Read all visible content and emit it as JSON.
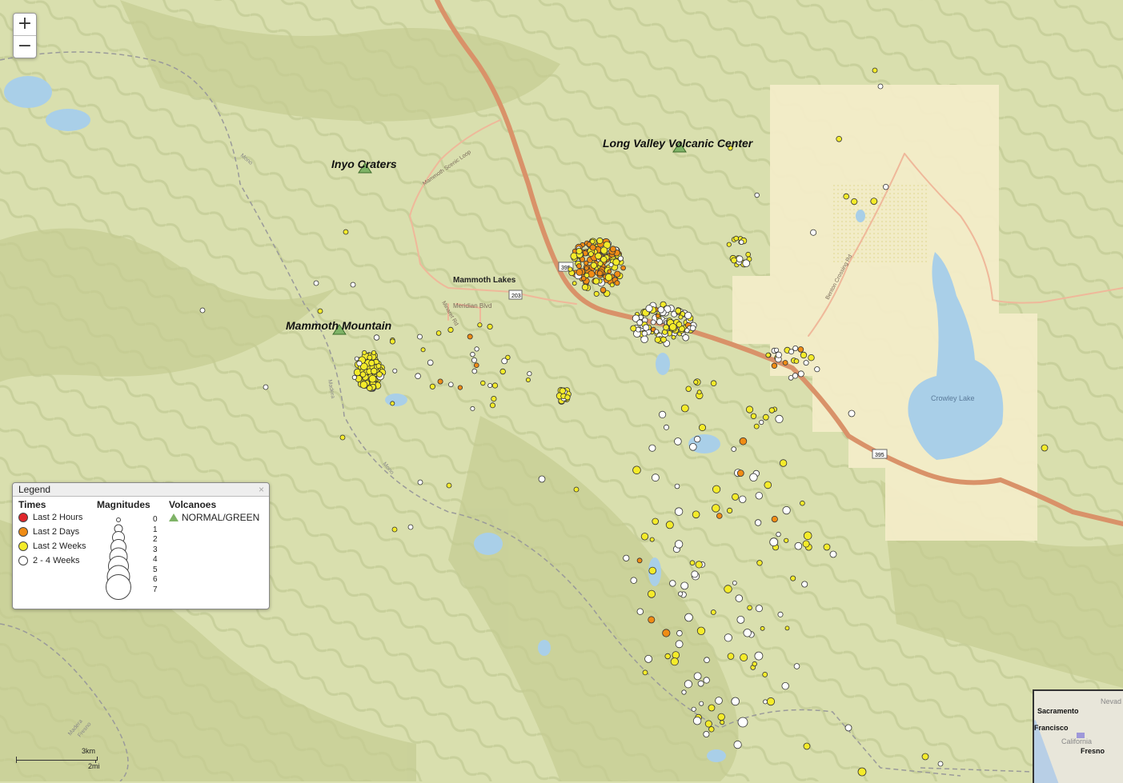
{
  "map": {
    "zoom_in_label": "+",
    "zoom_out_label": "−",
    "scale": {
      "km_label": "3km",
      "mi_label": "2mi"
    },
    "colors": {
      "terrain": "#d9dfae",
      "terrain_dark": "#c2cc93",
      "valley": "#f3ecc8",
      "water": "#a9cfe8",
      "road": "#d99269",
      "last_2_hours": "#e0262b",
      "last_2_days": "#f08c15",
      "last_2_weeks": "#f4eb2a",
      "weeks_2_4": "#ffffff",
      "volcano_green": "#7fb367"
    },
    "volcanoes": [
      {
        "name": "Inyo Craters"
      },
      {
        "name": "Long Valley Volcanic Center"
      },
      {
        "name": "Mammoth Mountain"
      }
    ],
    "place_labels": {
      "mammoth_lakes": "Mammoth Lakes",
      "meridian_blvd": "Meridian Blvd",
      "minaret_rd": "Minaret Rd",
      "scenic_loop": "Mammoth Scenic Loop",
      "benton_rd": "Benton Crossing Rd",
      "crowley_lake": "Crowley Lake",
      "hwy_395": "395",
      "hwy_203": "203",
      "madera_mono": "Madera",
      "mono_fresno": "Mono",
      "mono_label": "Mono",
      "madera_label": "Madera",
      "fresno_label": "Fresno"
    },
    "inset": {
      "sacramento": "Sacramento",
      "san_francisco": "Francisco",
      "california": "California",
      "fresno": "Fresno",
      "nevada": "Nevad"
    }
  },
  "legend": {
    "title": "Legend",
    "close": "×",
    "times_header": "Times",
    "times": [
      {
        "label": "Last 2 Hours",
        "color": "#e0262b"
      },
      {
        "label": "Last 2 Days",
        "color": "#f08c15"
      },
      {
        "label": "Last 2 Weeks",
        "color": "#f4eb2a"
      },
      {
        "label": "2 - 4 Weeks",
        "color": "#ffffff"
      }
    ],
    "magnitudes_header": "Magnitudes",
    "magnitudes": [
      "0",
      "1",
      "2",
      "3",
      "4",
      "5",
      "6",
      "7"
    ],
    "volcanoes_header": "Volcanoes",
    "volcano_status": "NORMAL/GREEN"
  }
}
